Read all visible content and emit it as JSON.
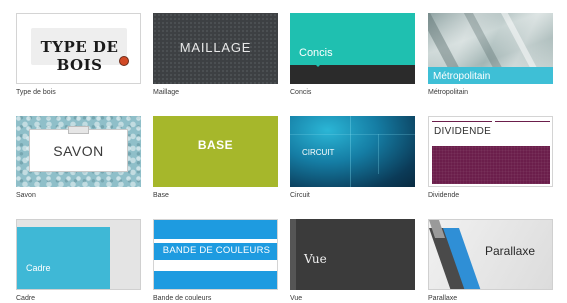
{
  "gallery": {
    "themes": [
      {
        "caption": "Type de bois",
        "thumb_text": "TYPE DE BOIS"
      },
      {
        "caption": "Maillage",
        "thumb_text": "MAILLAGE"
      },
      {
        "caption": "Concis",
        "thumb_text": "Concis"
      },
      {
        "caption": "Métropolitain",
        "thumb_text": "Métropolitain"
      },
      {
        "caption": "Savon",
        "thumb_text": "SAVON"
      },
      {
        "caption": "Base",
        "thumb_text": "BASE"
      },
      {
        "caption": "Circuit",
        "thumb_text": "CIRCUIT"
      },
      {
        "caption": "Dividende",
        "thumb_text": "DIVIDENDE"
      },
      {
        "caption": "Cadre",
        "thumb_text": "Cadre"
      },
      {
        "caption": "Bande de couleurs",
        "thumb_text": "BANDE DE COULEURS"
      },
      {
        "caption": "Vue",
        "thumb_text": "Vue"
      },
      {
        "caption": "Parallaxe",
        "thumb_text": "Parallaxe"
      }
    ]
  },
  "colors": {
    "concis": "#1fc0b0",
    "metropolitain_band": "#3ebfd6",
    "base": "#a6b72b",
    "dividende": "#6b1e4b",
    "cadre": "#3fb8d6",
    "bande": "#1e9be0",
    "parallaxe_accent": "#2f8fd6"
  }
}
